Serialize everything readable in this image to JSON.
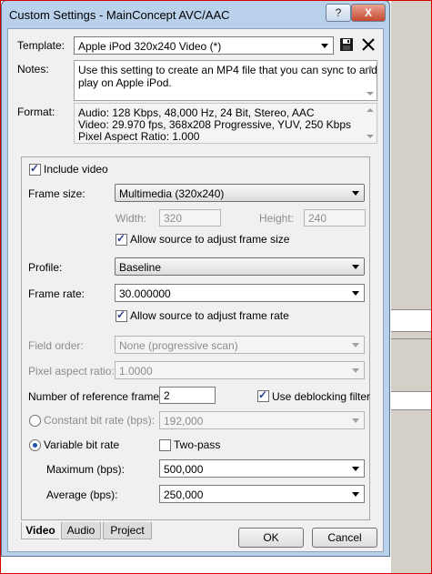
{
  "window": {
    "title": "Custom Settings - MainConcept AVC/AAC",
    "help_glyph": "?",
    "close_glyph": "X"
  },
  "template": {
    "label": "Template:",
    "value": "Apple iPod 320x240 Video (*)"
  },
  "notes": {
    "label": "Notes:",
    "lines": [
      "Use this setting to create an MP4 file that you can sync to and",
      "play on Apple iPod."
    ]
  },
  "format": {
    "label": "Format:",
    "lines": [
      "Audio: 128 Kbps, 48,000 Hz, 24 Bit, Stereo, AAC",
      "Video: 29.970 fps, 368x208 Progressive, YUV, 250 Kbps",
      "Pixel Aspect Ratio: 1.000"
    ]
  },
  "video": {
    "include_video": {
      "label": "Include video",
      "checked": true
    },
    "frame_size": {
      "label": "Frame size:",
      "value": "Multimedia (320x240)"
    },
    "width": {
      "label": "Width:",
      "value": "320"
    },
    "height": {
      "label": "Height:",
      "value": "240"
    },
    "allow_frame_size": {
      "label": "Allow source to adjust frame size",
      "checked": true
    },
    "profile": {
      "label": "Profile:",
      "value": "Baseline"
    },
    "frame_rate": {
      "label": "Frame rate:",
      "value": "30.000000"
    },
    "allow_frame_rate": {
      "label": "Allow source to adjust frame rate",
      "checked": true
    },
    "field_order": {
      "label": "Field order:",
      "value": "None (progressive scan)"
    },
    "pixel_aspect": {
      "label": "Pixel aspect ratio:",
      "value": "1.0000"
    },
    "ref_frames": {
      "label": "Number of reference frames:",
      "value": "2"
    },
    "deblocking": {
      "label": "Use deblocking filter",
      "checked": true
    },
    "constant_bitrate": {
      "label": "Constant bit rate (bps):",
      "value": "192,000",
      "selected": false
    },
    "variable_bitrate": {
      "label": "Variable bit rate",
      "selected": true
    },
    "two_pass": {
      "label": "Two-pass",
      "checked": false
    },
    "maximum": {
      "label": "Maximum (bps):",
      "value": "500,000"
    },
    "average": {
      "label": "Average (bps):",
      "value": "250,000"
    }
  },
  "tabs": [
    "Video",
    "Audio",
    "Project"
  ],
  "buttons": {
    "ok": "OK",
    "cancel": "Cancel"
  },
  "colors": {
    "title_bar": "#b9d1ea",
    "client": "#f0f0f0",
    "close_button": "#c44a2f",
    "screenshot_border": "#d40000"
  }
}
